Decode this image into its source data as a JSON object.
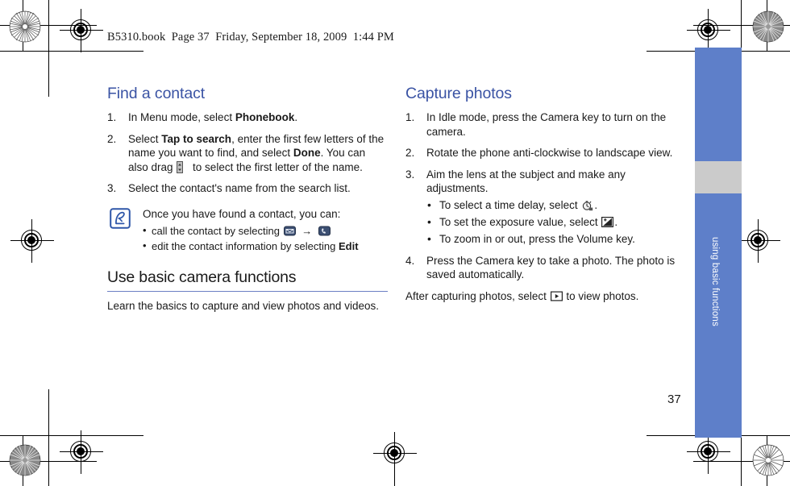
{
  "page": {
    "book_header": "B5310.book  Page 37  Friday, September 18, 2009  1:44 PM",
    "page_number": "37",
    "tab_label": "using basic functions",
    "accent_blue": "#3a53a4",
    "tab_blue": "#5e7fc9",
    "tab_gray": "#cbcbcb"
  },
  "left_column": {
    "heading": "Find a contact",
    "steps": [
      {
        "num": "1.",
        "parts": [
          {
            "t": "In Menu mode, select "
          },
          {
            "t": "Phonebook",
            "bold": true
          },
          {
            "t": "."
          }
        ]
      },
      {
        "num": "2.",
        "parts": [
          {
            "t": "Select "
          },
          {
            "t": "Tap to search",
            "bold": true
          },
          {
            "t": ", enter the first few letters of the name you want to find, and select "
          },
          {
            "t": "Done",
            "bold": true
          },
          {
            "t": ". You can also drag "
          },
          {
            "icon": "scroll-handle-icon"
          },
          {
            "t": " to select the first letter of the name."
          }
        ]
      },
      {
        "num": "3.",
        "parts": [
          {
            "t": "Select the contact's name from the search list."
          }
        ]
      }
    ],
    "note": {
      "icon": "note-pen-icon",
      "intro": "Once you have found a contact, you can:",
      "bullets": [
        {
          "parts": [
            {
              "t": "call the contact by selecting "
            },
            {
              "icon": "contact-card-icon"
            },
            {
              "t": " "
            },
            {
              "arrow": "→"
            },
            {
              "t": " "
            },
            {
              "icon": "phone-handset-icon"
            }
          ]
        },
        {
          "parts": [
            {
              "t": "edit the contact information by selecting "
            },
            {
              "t": "Edit",
              "bold": true
            }
          ]
        }
      ]
    },
    "section2": {
      "heading": "Use basic camera functions",
      "paragraph": "Learn the basics to capture and view photos and videos."
    }
  },
  "right_column": {
    "heading": "Capture photos",
    "steps": [
      {
        "num": "1.",
        "parts": [
          {
            "t": "In Idle mode, press the Camera key to turn on the camera."
          }
        ]
      },
      {
        "num": "2.",
        "parts": [
          {
            "t": "Rotate the phone anti-clockwise to landscape view."
          }
        ]
      },
      {
        "num": "3.",
        "parts": [
          {
            "t": "Aim the lens at the subject and make any adjustments."
          }
        ],
        "bullets": [
          {
            "parts": [
              {
                "t": "To select a time delay, select "
              },
              {
                "icon": "timer-icon"
              },
              {
                "t": "."
              }
            ]
          },
          {
            "parts": [
              {
                "t": "To set the exposure value, select "
              },
              {
                "icon": "exposure-icon"
              },
              {
                "t": "."
              }
            ]
          },
          {
            "parts": [
              {
                "t": "To zoom in or out, press the Volume key."
              }
            ]
          }
        ]
      },
      {
        "num": "4.",
        "parts": [
          {
            "t": "Press the Camera key to take a photo. The photo is saved automatically."
          }
        ]
      }
    ],
    "closing": {
      "parts": [
        {
          "t": "After capturing photos, select "
        },
        {
          "icon": "play-view-icon"
        },
        {
          "t": " to view photos."
        }
      ]
    }
  }
}
